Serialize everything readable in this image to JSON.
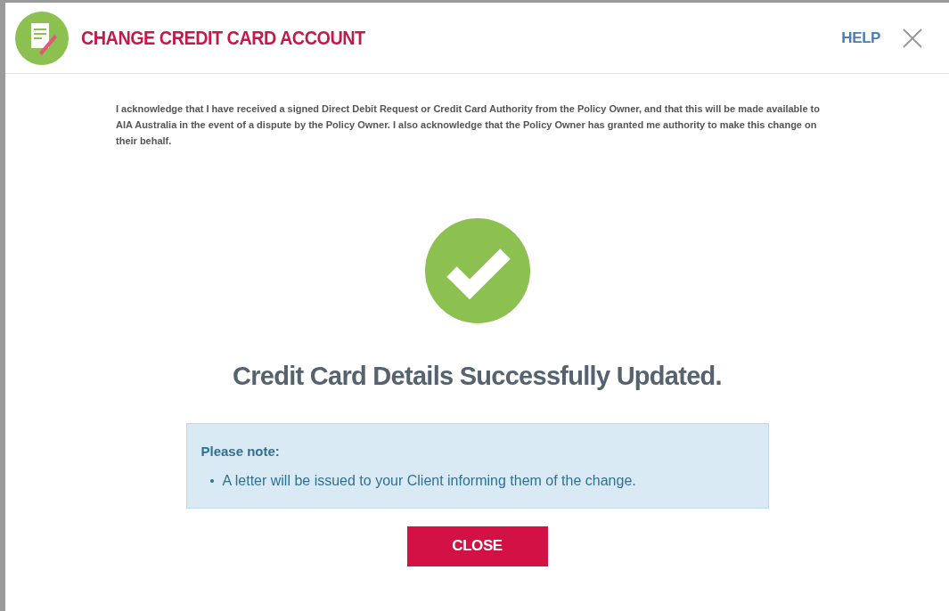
{
  "dialog": {
    "title": "CHANGE CREDIT CARD ACCOUNT",
    "help": "HELP",
    "acknowledgement": "I acknowledge that I have received a signed Direct Debit Request or Credit Card Authority from the Policy Owner, and that this will be made available to AIA Australia in the event of a dispute by the Policy Owner. I also acknowledge that the Policy Owner has granted me authority to make this change on their behalf.",
    "success_message": "Credit Card Details Successfully Updated.",
    "note": {
      "heading": "Please note:",
      "items": [
        "A letter will be issued to your Client informing them of the change."
      ]
    },
    "close_button": "CLOSE"
  }
}
